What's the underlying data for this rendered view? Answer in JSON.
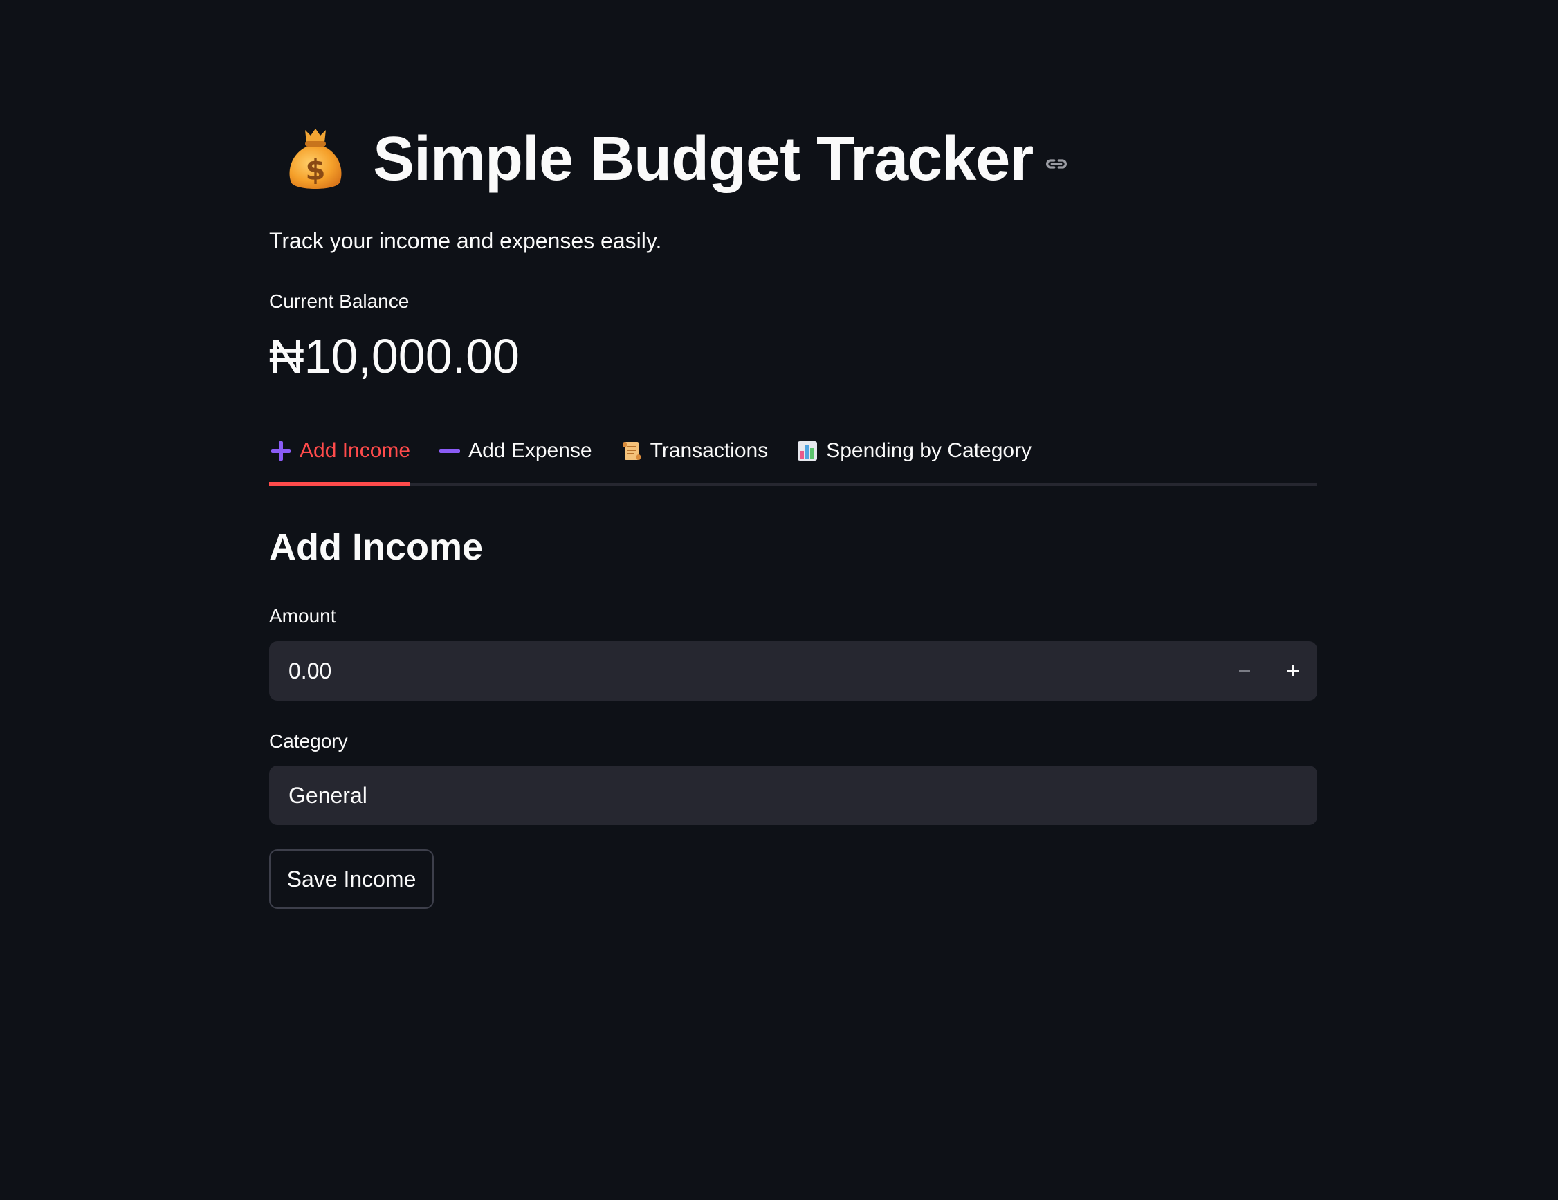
{
  "app": {
    "title": "Simple Budget Tracker",
    "title_icon": "money-bag-icon",
    "subtitle": "Track your income and expenses easily."
  },
  "balance": {
    "label": "Current Balance",
    "value": "₦10,000.00"
  },
  "tabs": [
    {
      "label": "Add Income",
      "icon": "plus-icon",
      "active": true
    },
    {
      "label": "Add Expense",
      "icon": "minus-icon",
      "active": false
    },
    {
      "label": "Transactions",
      "icon": "scroll-icon",
      "active": false
    },
    {
      "label": "Spending by Category",
      "icon": "bar-chart-icon",
      "active": false
    }
  ],
  "form": {
    "heading": "Add Income",
    "amount": {
      "label": "Amount",
      "value": "0.00"
    },
    "category": {
      "label": "Category",
      "value": "General"
    },
    "save_label": "Save Income"
  },
  "colors": {
    "background": "#0e1117",
    "accent": "#ff4b4b",
    "input_bg": "#262730",
    "text": "#fafafa",
    "tab_icon_purple": "#8b5cf6"
  }
}
